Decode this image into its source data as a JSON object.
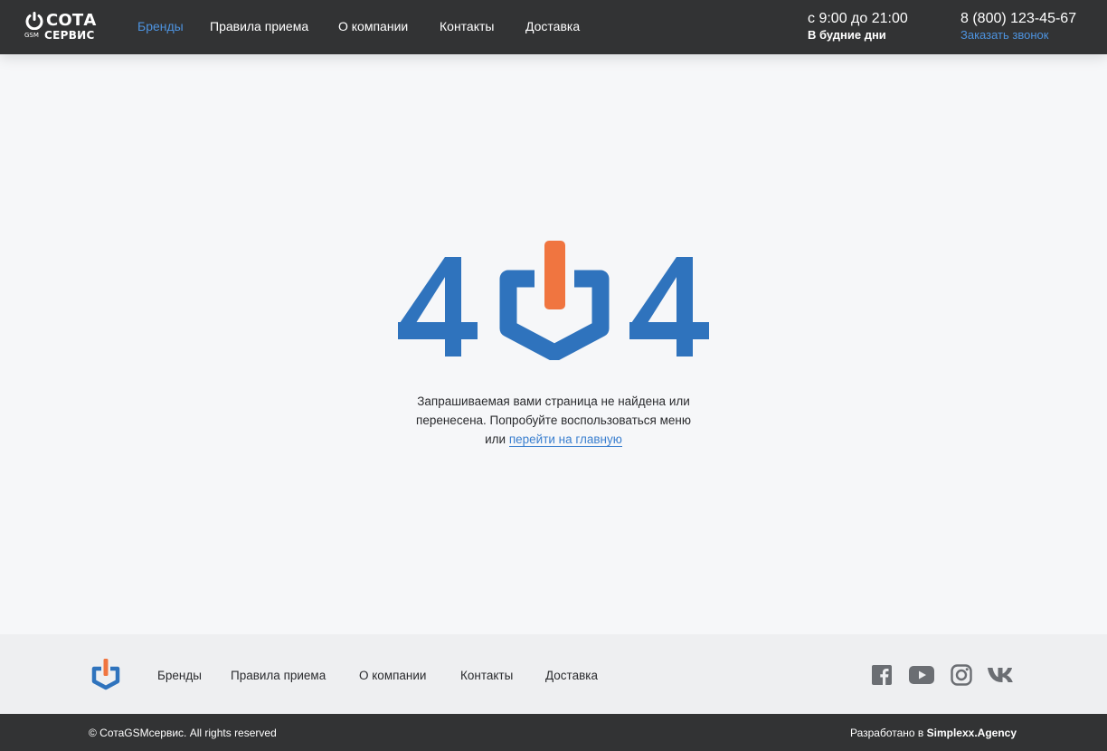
{
  "header": {
    "logo": {
      "word": "СОТА",
      "gsm": "GSM",
      "sub": "СЕРВИС"
    },
    "nav": [
      {
        "label": "Бренды",
        "active": true
      },
      {
        "label": "Правила приема",
        "active": false
      },
      {
        "label": "О компании",
        "active": false
      },
      {
        "label": "Контакты",
        "active": false
      },
      {
        "label": "Доставка",
        "active": false
      }
    ],
    "hours": {
      "time": "с 9:00 до 21:00",
      "days": "В будние дни"
    },
    "contact": {
      "phone": "8 (800) 123-45-67",
      "callback": "Заказать звонок"
    }
  },
  "error_page": {
    "code": "404",
    "message_line1": "Запрашиваемая вами страница не найдена или",
    "message_line2": "перенесена. Попробуйте воспользоваться меню",
    "message_prefix": "или ",
    "home_link": "перейти на главную"
  },
  "footer": {
    "nav": [
      {
        "label": "Бренды"
      },
      {
        "label": "Правила приема"
      },
      {
        "label": "О компании"
      },
      {
        "label": "Контакты"
      },
      {
        "label": "Доставка"
      }
    ],
    "social": [
      "facebook-icon",
      "youtube-icon",
      "instagram-icon",
      "vk-icon"
    ],
    "copyright": "© СотаGSMсервис. All rights reserved",
    "developer_prefix": "Разработано в ",
    "developer_name": "Simplexx.Agency"
  },
  "colors": {
    "header_bg": "#323334",
    "accent_blue": "#2f73bd",
    "link_blue": "#4d93df",
    "accent_orange": "#f07540",
    "page_bg": "#f6f7f9",
    "footer_bg": "#eeeff1",
    "social_gray": "#6b6e73"
  }
}
